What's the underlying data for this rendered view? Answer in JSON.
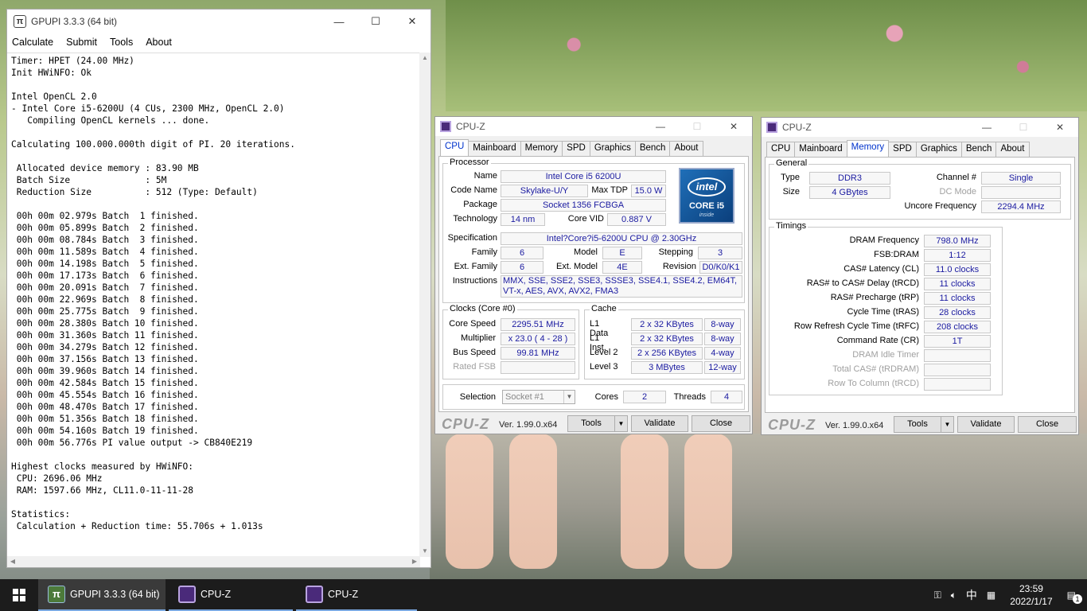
{
  "gpupi": {
    "title": "GPUPI 3.3.3 (64 bit)",
    "menu": [
      "Calculate",
      "Submit",
      "Tools",
      "About"
    ],
    "log": "Timer: HPET (24.00 MHz)\nInit HWiNFO: Ok\n\nIntel OpenCL 2.0\n- Intel Core i5-6200U (4 CUs, 2300 MHz, OpenCL 2.0)\n   Compiling OpenCL kernels ... done.\n\nCalculating 100.000.000th digit of PI. 20 iterations.\n\n Allocated device memory : 83.90 MB\n Batch Size              : 5M\n Reduction Size          : 512 (Type: Default)\n\n 00h 00m 02.979s Batch  1 finished.\n 00h 00m 05.899s Batch  2 finished.\n 00h 00m 08.784s Batch  3 finished.\n 00h 00m 11.589s Batch  4 finished.\n 00h 00m 14.198s Batch  5 finished.\n 00h 00m 17.173s Batch  6 finished.\n 00h 00m 20.091s Batch  7 finished.\n 00h 00m 22.969s Batch  8 finished.\n 00h 00m 25.775s Batch  9 finished.\n 00h 00m 28.380s Batch 10 finished.\n 00h 00m 31.360s Batch 11 finished.\n 00h 00m 34.279s Batch 12 finished.\n 00h 00m 37.156s Batch 13 finished.\n 00h 00m 39.960s Batch 14 finished.\n 00h 00m 42.584s Batch 15 finished.\n 00h 00m 45.554s Batch 16 finished.\n 00h 00m 48.470s Batch 17 finished.\n 00h 00m 51.356s Batch 18 finished.\n 00h 00m 54.160s Batch 19 finished.\n 00h 00m 56.776s PI value output -> CB840E219\n\nHighest clocks measured by HWiNFO:\n CPU: 2696.06 MHz\n RAM: 1597.66 MHz, CL11.0-11-11-28\n\nStatistics:\n Calculation + Reduction time: 55.706s + 1.013s"
  },
  "window_controls": {
    "minimize": "—",
    "maximize": "☐",
    "close": "✕"
  },
  "cpuz_common": {
    "title": "CPU-Z",
    "tabs": [
      "CPU",
      "Mainboard",
      "Memory",
      "SPD",
      "Graphics",
      "Bench",
      "About"
    ],
    "logo": "CPU-Z",
    "version": "Ver. 1.99.0.x64",
    "tools": "Tools",
    "validate": "Validate",
    "close": "Close"
  },
  "cpu": {
    "processor_group": "Processor",
    "name_label": "Name",
    "name": "Intel Core i5 6200U",
    "codename_label": "Code Name",
    "codename": "Skylake-U/Y",
    "maxtdp_label": "Max TDP",
    "maxtdp": "15.0 W",
    "package_label": "Package",
    "package": "Socket 1356 FCBGA",
    "technology_label": "Technology",
    "technology": "14 nm",
    "corevid_label": "Core VID",
    "corevid": "0.887 V",
    "spec_label": "Specification",
    "spec": "Intel?Core?i5-6200U CPU @ 2.30GHz",
    "family_label": "Family",
    "family": "6",
    "model_label": "Model",
    "model": "E",
    "stepping_label": "Stepping",
    "stepping": "3",
    "extfamily_label": "Ext. Family",
    "extfamily": "6",
    "extmodel_label": "Ext. Model",
    "extmodel": "4E",
    "revision_label": "Revision",
    "revision": "D0/K0/K1",
    "instructions_label": "Instructions",
    "instructions": "MMX, SSE, SSE2, SSE3, SSSE3, SSE4.1, SSE4.2, EM64T, VT-x, AES, AVX, AVX2, FMA3",
    "logo_intel": "intel",
    "logo_core": "CORE i5",
    "logo_inside": "inside",
    "clocks_group": "Clocks (Core #0)",
    "corespeed_label": "Core Speed",
    "corespeed": "2295.51 MHz",
    "multiplier_label": "Multiplier",
    "multiplier": "x 23.0 ( 4 - 28 )",
    "busspeed_label": "Bus Speed",
    "busspeed": "99.81 MHz",
    "ratedfsb_label": "Rated FSB",
    "ratedfsb": "",
    "cache_group": "Cache",
    "l1d_label": "L1 Data",
    "l1d": "2 x 32 KBytes",
    "l1d_way": "8-way",
    "l1i_label": "L1 Inst.",
    "l1i": "2 x 32 KBytes",
    "l1i_way": "8-way",
    "l2_label": "Level 2",
    "l2": "2 x 256 KBytes",
    "l2_way": "4-way",
    "l3_label": "Level 3",
    "l3": "3 MBytes",
    "l3_way": "12-way",
    "selection_label": "Selection",
    "selection": "Socket #1",
    "cores_label": "Cores",
    "cores": "2",
    "threads_label": "Threads",
    "threads": "4"
  },
  "memory": {
    "general_group": "General",
    "type_label": "Type",
    "type": "DDR3",
    "size_label": "Size",
    "size": "4 GBytes",
    "channel_label": "Channel #",
    "channel": "Single",
    "dcmode_label": "DC Mode",
    "dcmode": "",
    "uncore_label": "Uncore Frequency",
    "uncore": "2294.4 MHz",
    "timings_group": "Timings",
    "timings": [
      {
        "label": "DRAM Frequency",
        "value": "798.0 MHz",
        "dim": false
      },
      {
        "label": "FSB:DRAM",
        "value": "1:12",
        "dim": false
      },
      {
        "label": "CAS# Latency (CL)",
        "value": "11.0 clocks",
        "dim": false
      },
      {
        "label": "RAS# to CAS# Delay (tRCD)",
        "value": "11 clocks",
        "dim": false
      },
      {
        "label": "RAS# Precharge (tRP)",
        "value": "11 clocks",
        "dim": false
      },
      {
        "label": "Cycle Time (tRAS)",
        "value": "28 clocks",
        "dim": false
      },
      {
        "label": "Row Refresh Cycle Time (tRFC)",
        "value": "208 clocks",
        "dim": false
      },
      {
        "label": "Command Rate (CR)",
        "value": "1T",
        "dim": false
      },
      {
        "label": "DRAM Idle Timer",
        "value": "",
        "dim": true
      },
      {
        "label": "Total CAS# (tRDRAM)",
        "value": "",
        "dim": true
      },
      {
        "label": "Row To Column (tRCD)",
        "value": "",
        "dim": true
      }
    ]
  },
  "taskbar": {
    "items": [
      {
        "label": "GPUPI 3.3.3 (64 bit)",
        "icon": "pi"
      },
      {
        "label": "CPU-Z",
        "icon": "cz"
      },
      {
        "label": "CPU-Z",
        "icon": "cz"
      }
    ],
    "ime": "中",
    "time": "23:59",
    "date": "2022/1/17",
    "notification_count": "1"
  }
}
